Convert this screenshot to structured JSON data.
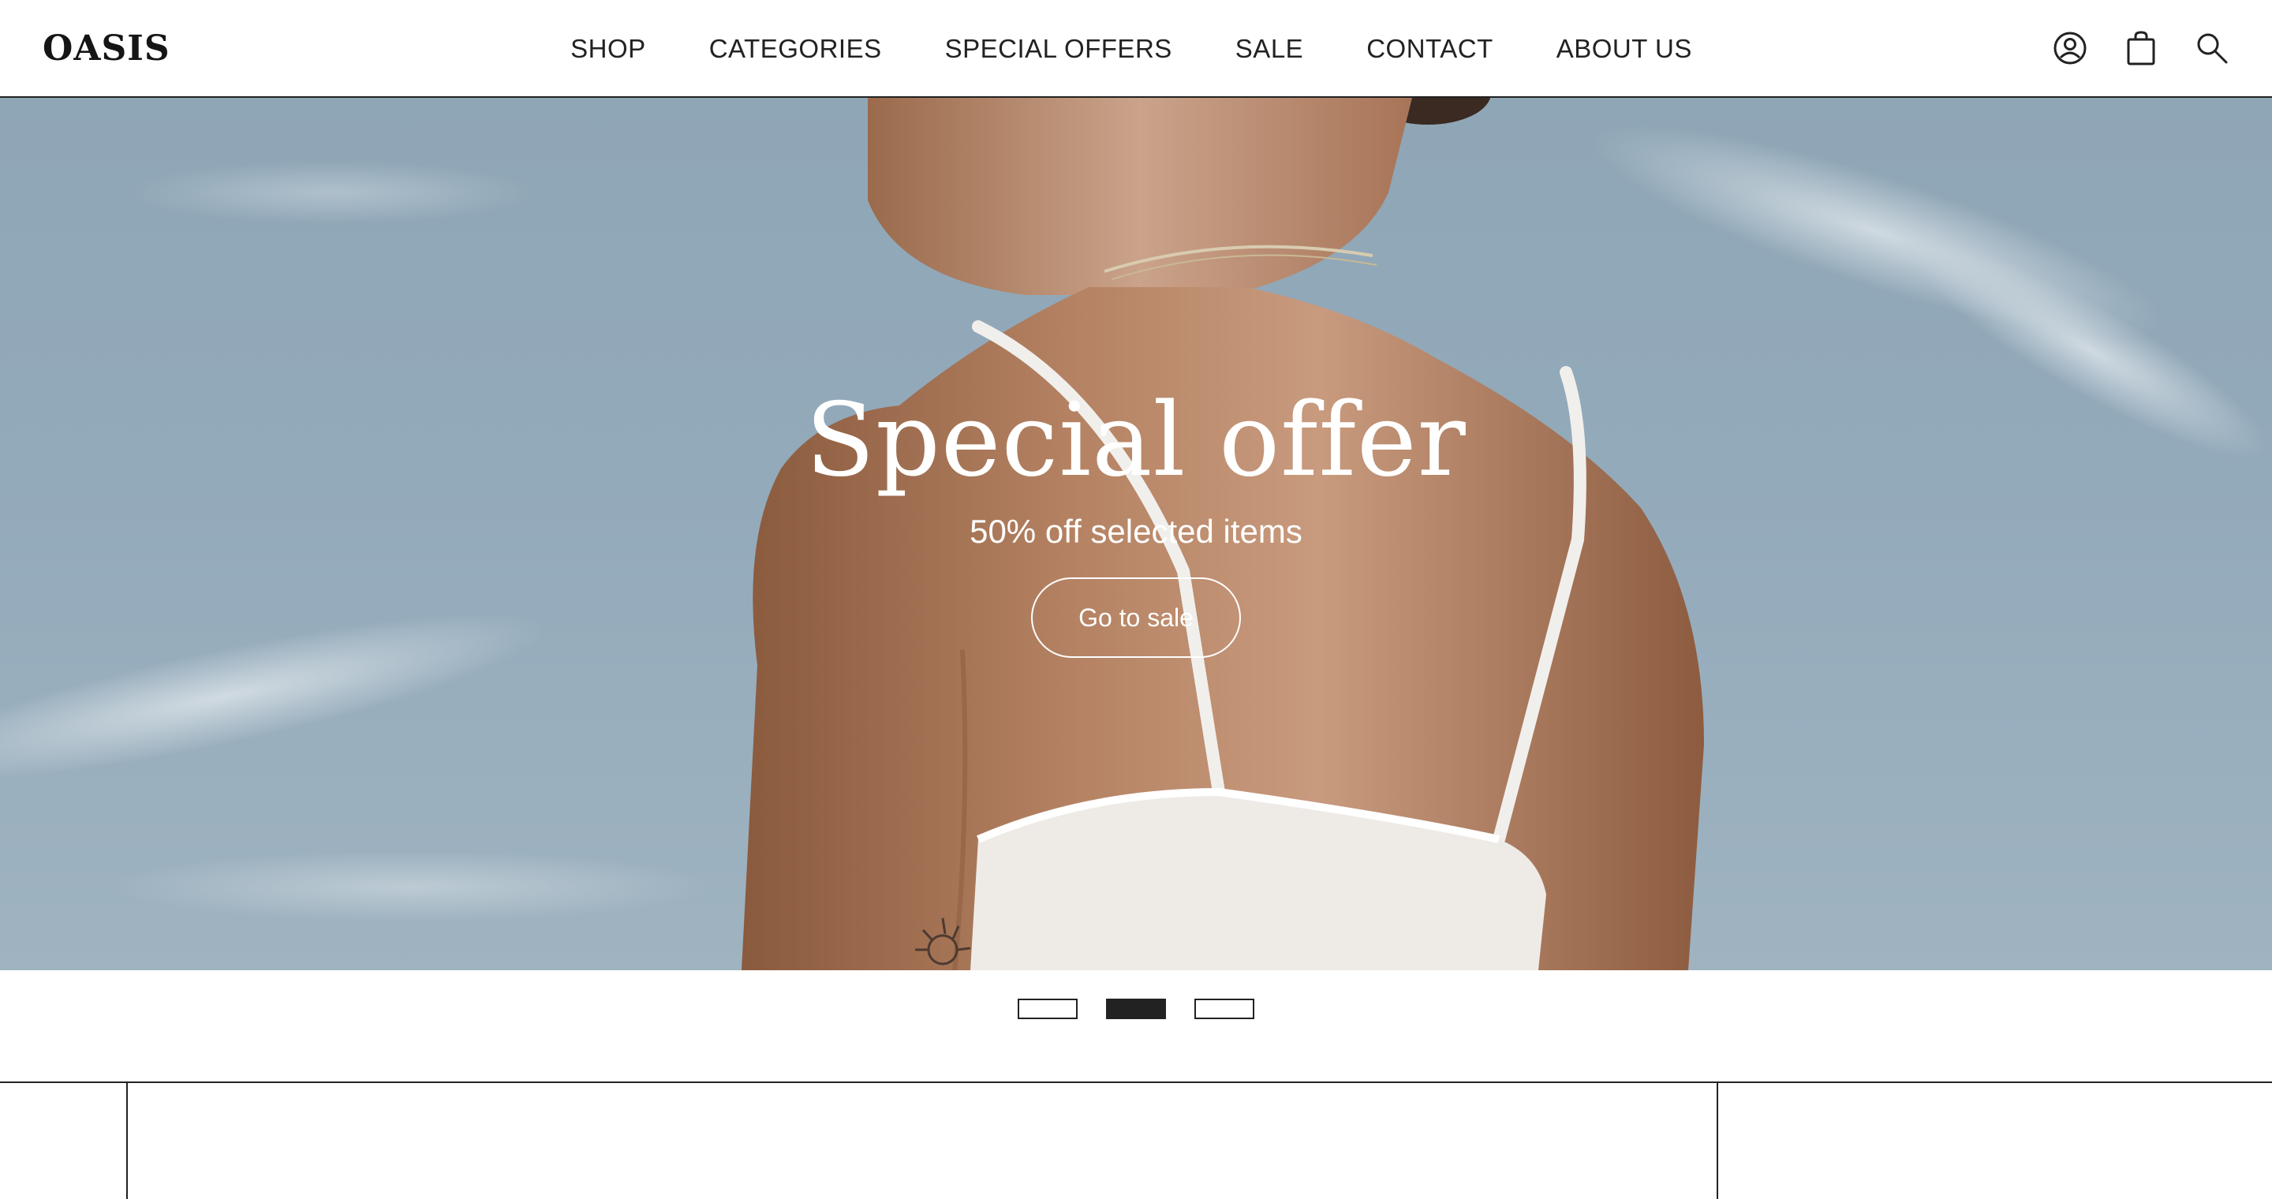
{
  "brand": {
    "logo_text": "OASIS"
  },
  "nav": {
    "items": [
      {
        "label": "SHOP"
      },
      {
        "label": "CATEGORIES"
      },
      {
        "label": "SPECIAL OFFERS"
      },
      {
        "label": "SALE"
      },
      {
        "label": "CONTACT"
      },
      {
        "label": "ABOUT US"
      }
    ]
  },
  "header_icons": [
    "account-icon",
    "shopping-bag-icon",
    "search-icon"
  ],
  "hero": {
    "title": "Special offer",
    "subtitle": "50% off selected items",
    "cta_label": "Go to sale"
  },
  "slider": {
    "count": 3,
    "active_index": 1
  },
  "colors": {
    "text": "#222222",
    "hero_text": "#ffffff",
    "sky": "#93aabb",
    "background": "#ffffff"
  }
}
